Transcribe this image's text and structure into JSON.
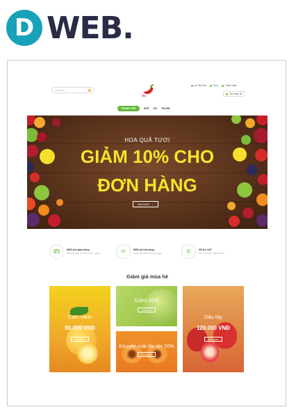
{
  "brand": {
    "letter": "D",
    "text": "WEB."
  },
  "site": {
    "search": {
      "placeholder": "Tìm kiếm..."
    },
    "logo_text": "Hot",
    "top_links": [
      "Ưu đãi Dịch",
      "Thực",
      "Thanh toán"
    ],
    "cart": "Giỏ hàng: 0đ",
    "nav": [
      "TRANG CHỦ",
      "GIỚI",
      "HỢ",
      "TIN ĐB"
    ],
    "hero": {
      "sub": "HOA QUẢ TƯƠI",
      "line1": "GIẢM 10% CHO",
      "line2": "ĐƠN HÀNG",
      "button": "MUA NGAY"
    },
    "features": [
      {
        "title": "Miễn phí giao hàng",
        "desc": "Miễn phí giao cho đơn hàng > 300k"
      },
      {
        "title": "Miễn phí trả hàng",
        "desc": "Hoàn tiền 100% trong 30 ngày"
      },
      {
        "title": "Hỗ trợ 24/7",
        "desc": "Hỗ trợ tận tâm, giải đáp 24h"
      }
    ],
    "section_title": "Giảm giá mùa hè",
    "cards": [
      {
        "label": "Cam sành",
        "price": "90.000 VNĐ",
        "button": "MUA NGAY"
      },
      {
        "label": "Giảm 20%",
        "button": "MUA NGAY"
      },
      {
        "label": "Khuyến mãi lên tới 70%",
        "button": "MUA NGAY"
      },
      {
        "label": "Dâu tây",
        "price": "120.000 VNĐ",
        "button": "MUA NGAY"
      }
    ]
  }
}
